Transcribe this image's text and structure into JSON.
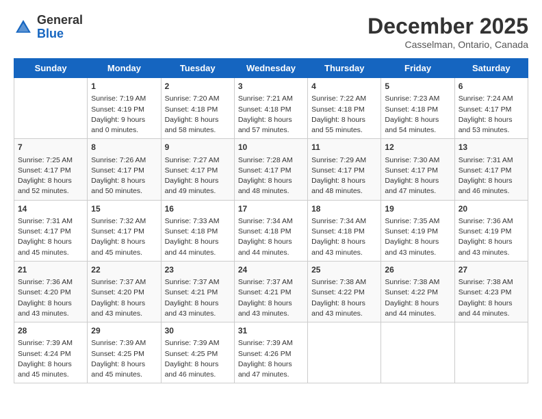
{
  "header": {
    "logo_line1": "General",
    "logo_line2": "Blue",
    "month": "December 2025",
    "location": "Casselman, Ontario, Canada"
  },
  "days_of_week": [
    "Sunday",
    "Monday",
    "Tuesday",
    "Wednesday",
    "Thursday",
    "Friday",
    "Saturday"
  ],
  "weeks": [
    [
      {
        "day": "",
        "content": ""
      },
      {
        "day": "1",
        "content": "Sunrise: 7:19 AM\nSunset: 4:19 PM\nDaylight: 9 hours\nand 0 minutes."
      },
      {
        "day": "2",
        "content": "Sunrise: 7:20 AM\nSunset: 4:18 PM\nDaylight: 8 hours\nand 58 minutes."
      },
      {
        "day": "3",
        "content": "Sunrise: 7:21 AM\nSunset: 4:18 PM\nDaylight: 8 hours\nand 57 minutes."
      },
      {
        "day": "4",
        "content": "Sunrise: 7:22 AM\nSunset: 4:18 PM\nDaylight: 8 hours\nand 55 minutes."
      },
      {
        "day": "5",
        "content": "Sunrise: 7:23 AM\nSunset: 4:18 PM\nDaylight: 8 hours\nand 54 minutes."
      },
      {
        "day": "6",
        "content": "Sunrise: 7:24 AM\nSunset: 4:17 PM\nDaylight: 8 hours\nand 53 minutes."
      }
    ],
    [
      {
        "day": "7",
        "content": "Sunrise: 7:25 AM\nSunset: 4:17 PM\nDaylight: 8 hours\nand 52 minutes."
      },
      {
        "day": "8",
        "content": "Sunrise: 7:26 AM\nSunset: 4:17 PM\nDaylight: 8 hours\nand 50 minutes."
      },
      {
        "day": "9",
        "content": "Sunrise: 7:27 AM\nSunset: 4:17 PM\nDaylight: 8 hours\nand 49 minutes."
      },
      {
        "day": "10",
        "content": "Sunrise: 7:28 AM\nSunset: 4:17 PM\nDaylight: 8 hours\nand 48 minutes."
      },
      {
        "day": "11",
        "content": "Sunrise: 7:29 AM\nSunset: 4:17 PM\nDaylight: 8 hours\nand 48 minutes."
      },
      {
        "day": "12",
        "content": "Sunrise: 7:30 AM\nSunset: 4:17 PM\nDaylight: 8 hours\nand 47 minutes."
      },
      {
        "day": "13",
        "content": "Sunrise: 7:31 AM\nSunset: 4:17 PM\nDaylight: 8 hours\nand 46 minutes."
      }
    ],
    [
      {
        "day": "14",
        "content": "Sunrise: 7:31 AM\nSunset: 4:17 PM\nDaylight: 8 hours\nand 45 minutes."
      },
      {
        "day": "15",
        "content": "Sunrise: 7:32 AM\nSunset: 4:17 PM\nDaylight: 8 hours\nand 45 minutes."
      },
      {
        "day": "16",
        "content": "Sunrise: 7:33 AM\nSunset: 4:18 PM\nDaylight: 8 hours\nand 44 minutes."
      },
      {
        "day": "17",
        "content": "Sunrise: 7:34 AM\nSunset: 4:18 PM\nDaylight: 8 hours\nand 44 minutes."
      },
      {
        "day": "18",
        "content": "Sunrise: 7:34 AM\nSunset: 4:18 PM\nDaylight: 8 hours\nand 43 minutes."
      },
      {
        "day": "19",
        "content": "Sunrise: 7:35 AM\nSunset: 4:19 PM\nDaylight: 8 hours\nand 43 minutes."
      },
      {
        "day": "20",
        "content": "Sunrise: 7:36 AM\nSunset: 4:19 PM\nDaylight: 8 hours\nand 43 minutes."
      }
    ],
    [
      {
        "day": "21",
        "content": "Sunrise: 7:36 AM\nSunset: 4:20 PM\nDaylight: 8 hours\nand 43 minutes."
      },
      {
        "day": "22",
        "content": "Sunrise: 7:37 AM\nSunset: 4:20 PM\nDaylight: 8 hours\nand 43 minutes."
      },
      {
        "day": "23",
        "content": "Sunrise: 7:37 AM\nSunset: 4:21 PM\nDaylight: 8 hours\nand 43 minutes."
      },
      {
        "day": "24",
        "content": "Sunrise: 7:37 AM\nSunset: 4:21 PM\nDaylight: 8 hours\nand 43 minutes."
      },
      {
        "day": "25",
        "content": "Sunrise: 7:38 AM\nSunset: 4:22 PM\nDaylight: 8 hours\nand 43 minutes."
      },
      {
        "day": "26",
        "content": "Sunrise: 7:38 AM\nSunset: 4:22 PM\nDaylight: 8 hours\nand 44 minutes."
      },
      {
        "day": "27",
        "content": "Sunrise: 7:38 AM\nSunset: 4:23 PM\nDaylight: 8 hours\nand 44 minutes."
      }
    ],
    [
      {
        "day": "28",
        "content": "Sunrise: 7:39 AM\nSunset: 4:24 PM\nDaylight: 8 hours\nand 45 minutes."
      },
      {
        "day": "29",
        "content": "Sunrise: 7:39 AM\nSunset: 4:25 PM\nDaylight: 8 hours\nand 45 minutes."
      },
      {
        "day": "30",
        "content": "Sunrise: 7:39 AM\nSunset: 4:25 PM\nDaylight: 8 hours\nand 46 minutes."
      },
      {
        "day": "31",
        "content": "Sunrise: 7:39 AM\nSunset: 4:26 PM\nDaylight: 8 hours\nand 47 minutes."
      },
      {
        "day": "",
        "content": ""
      },
      {
        "day": "",
        "content": ""
      },
      {
        "day": "",
        "content": ""
      }
    ]
  ]
}
